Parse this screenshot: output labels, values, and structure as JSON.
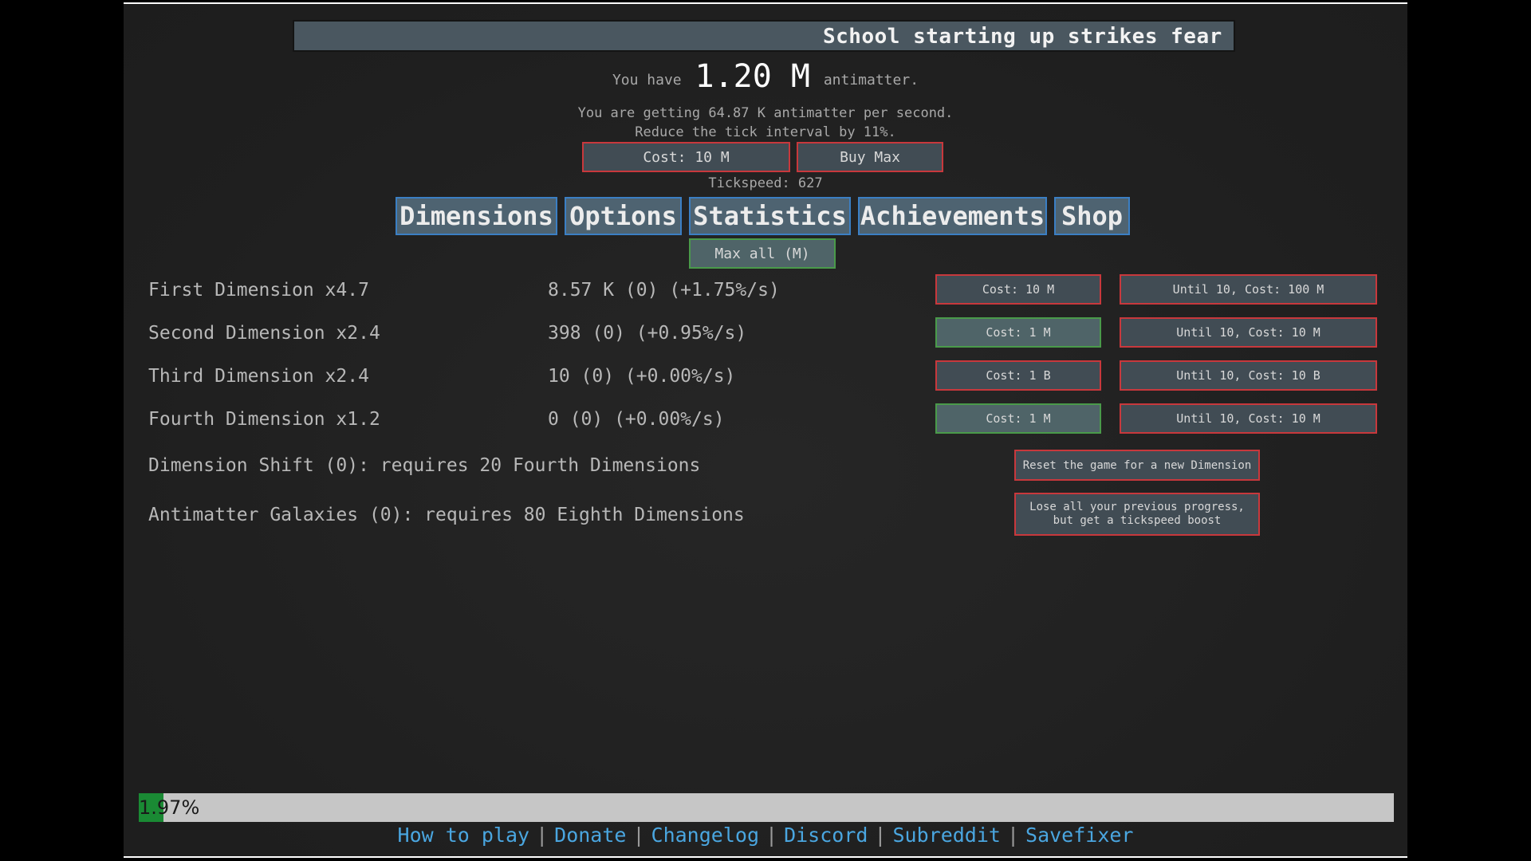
{
  "news": {
    "ticker": "School starting up strikes fear in stud"
  },
  "header": {
    "you_have": "You have",
    "amount": "1.20 M",
    "unit": "antimatter.",
    "per_second": "You are getting 64.87 K antimatter per second.",
    "reduce_tick": "Reduce the tick interval by 11%.",
    "tick_cost": "Cost: 10 M",
    "buy_max": "Buy Max",
    "tickspeed": "Tickspeed: 627"
  },
  "tabs": [
    {
      "label": "Dimensions"
    },
    {
      "label": "Options"
    },
    {
      "label": "Statistics"
    },
    {
      "label": "Achievements"
    },
    {
      "label": "Shop"
    }
  ],
  "max_all": "Max all (M)",
  "dimensions": [
    {
      "name": "First Dimension x4.7",
      "value": "8.57 K (0) (+1.75%/s)",
      "cost": "Cost: 10 M",
      "cost_state": "unaffordable",
      "until": "Until 10, Cost: 100 M"
    },
    {
      "name": "Second Dimension x2.4",
      "value": "398 (0) (+0.95%/s)",
      "cost": "Cost: 1 M",
      "cost_state": "affordable",
      "until": "Until 10, Cost: 10 M"
    },
    {
      "name": "Third Dimension x2.4",
      "value": "10 (0) (+0.00%/s)",
      "cost": "Cost: 1 B",
      "cost_state": "unaffordable",
      "until": "Until 10, Cost: 10 B"
    },
    {
      "name": "Fourth Dimension x1.2",
      "value": "0 (0) (+0.00%/s)",
      "cost": "Cost: 1 M",
      "cost_state": "affordable",
      "until": "Until 10, Cost: 10 M"
    }
  ],
  "shift": {
    "text": "Dimension Shift (0): requires 20 Fourth Dimensions",
    "button": "Reset the game for a new Dimension"
  },
  "galaxy": {
    "text": "Antimatter Galaxies (0): requires 80 Eighth Dimensions",
    "button_line1": "Lose all your previous progress,",
    "button_line2": "but get a tickspeed boost"
  },
  "progress": {
    "label": "1.97%",
    "value": 1.97
  },
  "footer": {
    "links": [
      "How to play",
      "Donate",
      "Changelog",
      "Discord",
      "Subreddit",
      "Savefixer"
    ],
    "separator": "|"
  },
  "colors": {
    "red_border": "#c8383c",
    "green_border": "#4a9a4a",
    "tab_border": "#3b7fc4",
    "link": "#4aa6e0",
    "progress_fill": "#1a8a34"
  }
}
